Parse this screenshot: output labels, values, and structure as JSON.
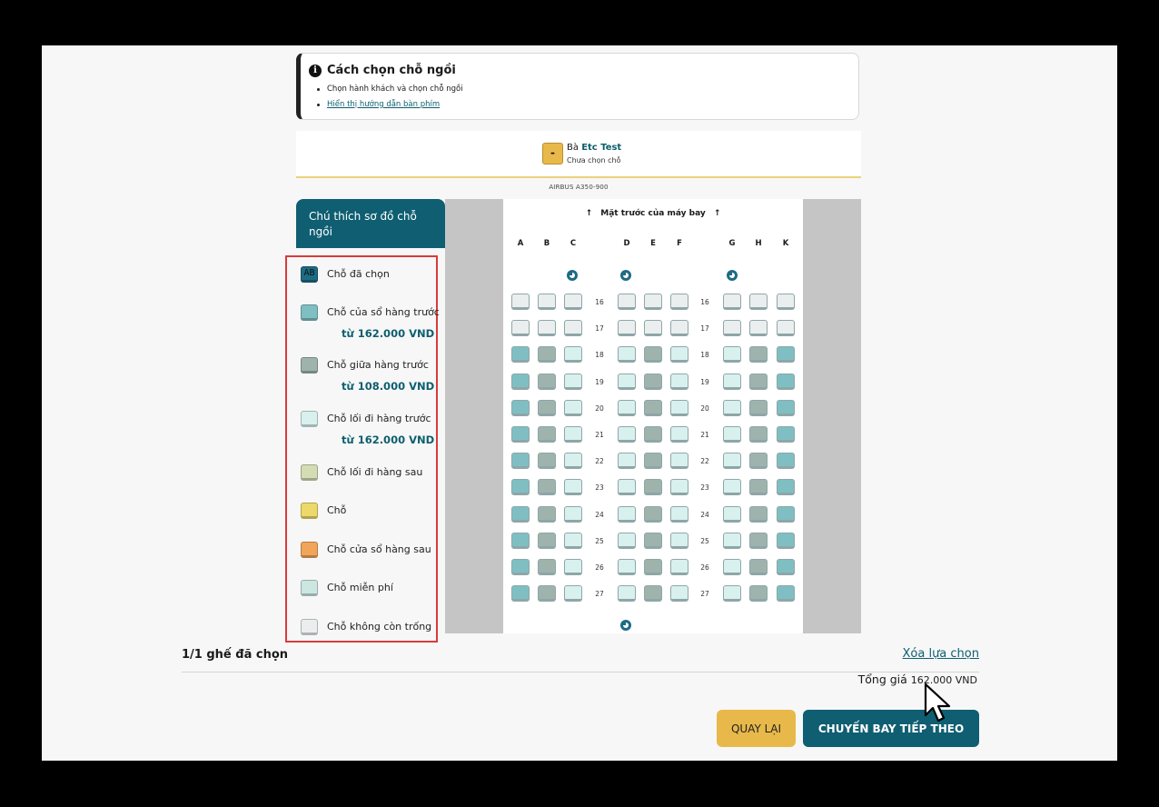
{
  "info": {
    "title": "Cách chọn chỗ ngồi",
    "steps": [
      "Chọn hành khách và chọn chỗ ngồi"
    ],
    "link": "Hiển thị hướng dẫn bàn phím"
  },
  "passenger": {
    "badge": "-",
    "title": "Bà",
    "name": "Etc Test",
    "status": "Chưa chọn chỗ"
  },
  "aircraft": "AIRBUS A350-900",
  "legend": {
    "title": "Chú thích sơ đồ chỗ ngồi",
    "items": [
      {
        "label": "Chỗ đã chọn",
        "code": "AB",
        "color": "#1e6b85",
        "price": ""
      },
      {
        "label": "Chỗ của sổ hàng trước",
        "code": "",
        "color": "#7fbfc3",
        "price": "từ 162.000 VND"
      },
      {
        "label": "Chỗ giữa hàng trước",
        "code": "",
        "color": "#9fb3ad",
        "price": "từ 108.000 VND"
      },
      {
        "label": "Chỗ lối đi hàng trước",
        "code": "",
        "color": "#d8f1ee",
        "price": "từ 162.000 VND"
      },
      {
        "label": "Chỗ lối đi hàng sau",
        "code": "",
        "color": "#d4dcb4",
        "price": ""
      },
      {
        "label": "Chỗ",
        "code": "",
        "color": "#ecd96a",
        "price": ""
      },
      {
        "label": "Chỗ cửa sổ hàng sau",
        "code": "",
        "color": "#f0a55a",
        "price": ""
      },
      {
        "label": "Chỗ miễn phí",
        "code": "",
        "color": "#cce6e2",
        "price": ""
      },
      {
        "label": "Chỗ không còn trống",
        "code": "",
        "color": "#eaeeee",
        "price": ""
      }
    ]
  },
  "seatmap": {
    "front_label": "Mặt trước của máy bay",
    "columns": [
      "A",
      "B",
      "C",
      "D",
      "E",
      "F",
      "G",
      "H",
      "K"
    ],
    "rows": [
      16,
      17,
      18,
      19,
      20,
      21,
      22,
      23,
      24,
      25,
      26,
      27
    ],
    "seat_colors": {
      "unavailable": "#eaeeee",
      "window": "#7fbfc3",
      "middle": "#9fb3ad",
      "aisle": "#d8f1ee"
    },
    "seat_types": {
      "unavailable": [
        "U",
        "U",
        "U",
        "U",
        "U",
        "U",
        "U",
        "U",
        "U"
      ],
      "available": [
        "W",
        "M",
        "A",
        "A",
        "M",
        "A",
        "A",
        "M",
        "W"
      ]
    },
    "unavailable_rows": [
      16,
      17
    ]
  },
  "summary": {
    "seat_count": "1/1 ghế đã chọn",
    "clear": "Xóa lựa chọn",
    "total_label": "Tổng giá",
    "total_amount": "162.000 VND"
  },
  "buttons": {
    "back": "QUAY LẠI",
    "next": "CHUYẾN BAY TIẾP THEO"
  }
}
